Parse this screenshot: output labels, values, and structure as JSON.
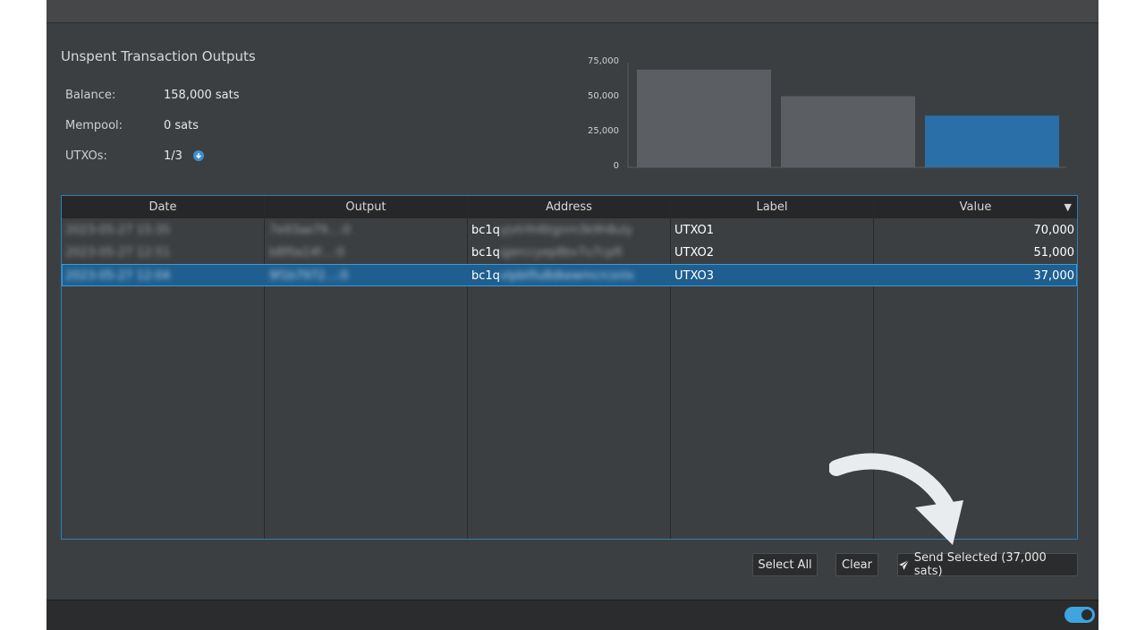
{
  "panel": {
    "title": "Unspent Transaction Outputs",
    "balance_label": "Balance:",
    "balance_value": "158,000 sats",
    "mempool_label": "Mempool:",
    "mempool_value": "0 sats",
    "utxos_label": "UTXOs:",
    "utxos_value": "1/3"
  },
  "chart_data": {
    "type": "bar",
    "categories": [
      "UTXO1",
      "UTXO2",
      "UTXO3"
    ],
    "values": [
      70000,
      51000,
      37000
    ],
    "yticks": [
      "75,000",
      "50,000",
      "25,000",
      "0"
    ],
    "ylim": [
      0,
      75000
    ],
    "selected_index": 2,
    "colors": {
      "bar": "#5b5e62",
      "selected": "#2a6fa8"
    }
  },
  "table": {
    "columns": [
      "Date",
      "Output",
      "Address",
      "Label",
      "Value"
    ],
    "sort_indicator": "▼",
    "rows": [
      {
        "date": "2023-05-27 15:35",
        "output": "7e93ae79…:0",
        "address_prefix": "bc1q",
        "address_rest": "yjvtrlhl6tgnrn3k9h8uly",
        "label": "UTXO1",
        "value": "70,000"
      },
      {
        "date": "2023-05-27 12:51",
        "output": "b8f0a14f…:0",
        "address_prefix": "bc1q",
        "address_rest": "qjerccyep8bv7u7cpft",
        "label": "UTXO2",
        "value": "51,000"
      },
      {
        "date": "2023-05-27 12:04",
        "output": "9f1b7972…:0",
        "address_prefix": "bc1q",
        "address_rest": "vlpbtfiu8dkewmcrcsnlx",
        "label": "UTXO3",
        "value": "37,000"
      }
    ]
  },
  "buttons": {
    "select_all": "Select All",
    "clear": "Clear",
    "send_selected": "Send Selected (37,000 sats)"
  },
  "icons": {
    "utxo_info": "arrow-down-circle-icon",
    "send": "paper-plane-icon",
    "annotation": "curved-arrow-icon",
    "status": "toggle-icon"
  }
}
